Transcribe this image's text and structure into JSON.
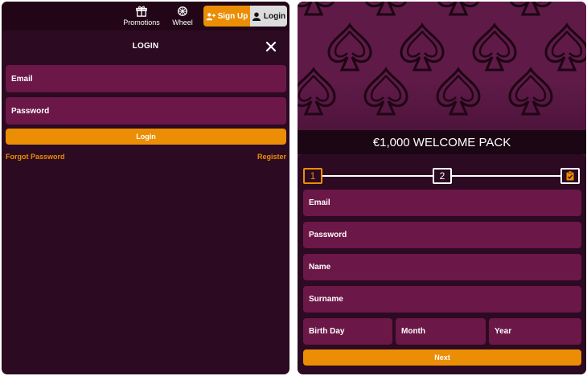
{
  "colors": {
    "panel_bg": "#2c0a22",
    "topbar_bg": "#220618",
    "field_bg": "#6b1748",
    "accent_orange": "#eb8e05",
    "banner_bg": "#5f1a48",
    "login_button_bg": "#dcdcdc"
  },
  "header": {
    "promotions_label": "Promotions",
    "promotions_icon": "gift-icon",
    "wheel_label": "Wheel",
    "wheel_icon": "wheel-icon",
    "signup_label": "Sign Up",
    "signup_icon": "user-plus-icon",
    "login_label": "Login",
    "login_icon": "user-icon"
  },
  "login_form": {
    "title": "LOGIN",
    "close_icon": "close-icon",
    "email_label": "Email",
    "password_label": "Password",
    "submit_label": "Login",
    "forgot_password": "Forgot Password",
    "register": "Register"
  },
  "signup_form": {
    "banner_pattern": "spade-pattern",
    "promo_title": "€1,000 WELCOME PACK",
    "steps": [
      {
        "label": "1",
        "active": true
      },
      {
        "label": "2",
        "active": false
      },
      {
        "label": "",
        "icon": "clipboard-check-icon",
        "active": false
      }
    ],
    "email_label": "Email",
    "password_label": "Password",
    "name_label": "Name",
    "surname_label": "Surname",
    "birth_day_label": "Birth Day",
    "month_label": "Month",
    "year_label": "Year",
    "next_label": "Next"
  }
}
